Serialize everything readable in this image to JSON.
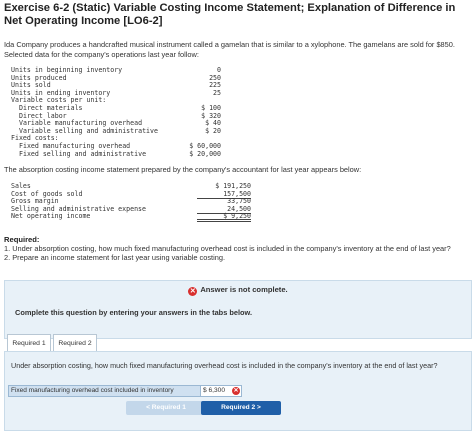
{
  "header": {
    "title": "Exercise 6-2 (Static) Variable Costing Income Statement; Explanation of Difference in Net Operating Income [LO6-2]",
    "intro": "Ida Company produces a handcrafted musical instrument called a gamelan that is similar to a xylophone. The gamelans are sold for $850. Selected data for the company's operations last year follow:"
  },
  "data_table": {
    "rows": [
      {
        "label": "Units in beginning inventory",
        "value": "0"
      },
      {
        "label": "Units produced",
        "value": "250"
      },
      {
        "label": "Units sold",
        "value": "225"
      },
      {
        "label": "Units in ending inventory",
        "value": "25"
      },
      {
        "label": "Variable costs per unit:",
        "value": ""
      },
      {
        "label": "Direct materials",
        "value": "$ 100"
      },
      {
        "label": "Direct labor",
        "value": "$ 320"
      },
      {
        "label": "Variable manufacturing overhead",
        "value": "$ 40"
      },
      {
        "label": "Variable selling and administrative",
        "value": "$ 20"
      },
      {
        "label": "Fixed costs:",
        "value": ""
      },
      {
        "label": "Fixed manufacturing overhead",
        "value": "$ 60,000"
      },
      {
        "label": "Fixed selling and administrative",
        "value": "$ 20,000"
      }
    ]
  },
  "absorption_sentence": "The absorption costing income statement prepared by the company's accountant for last year appears below:",
  "absorption_table": {
    "rows": [
      {
        "label": "Sales",
        "value": "$ 191,250"
      },
      {
        "label": "Cost of goods sold",
        "value": "157,500"
      },
      {
        "label": "Gross margin",
        "value": "33,750"
      },
      {
        "label": "Selling and administrative expense",
        "value": "24,500"
      },
      {
        "label": "Net operating income",
        "value": "$ 9,250"
      }
    ]
  },
  "required": {
    "heading": "Required:",
    "item1": "1. Under absorption costing, how much fixed manufacturing overhead cost is included in the company's inventory at the end of last year?",
    "item2": "2. Prepare an income statement for last year using variable costing."
  },
  "status": {
    "icon": "x-circle-icon",
    "not_complete": "Answer is not complete.",
    "complete_prompt": "Complete this question by entering your answers in the tabs below."
  },
  "tabs": [
    {
      "label": "Required 1",
      "active": true
    },
    {
      "label": "Required 2",
      "active": false
    }
  ],
  "panel": {
    "question": "Under absorption costing, how much fixed manufacturing overhead cost is included in the company's inventory at the end of last year?",
    "answer_label": "Fixed manufacturing overhead cost included in inventory",
    "answer_value": "$ 6,300"
  },
  "nav": {
    "prev_label": "< Required 1",
    "next_label": "Required 2 >"
  },
  "colors": {
    "accent": "#1f5fa8",
    "banner_bg": "#e8f1f8",
    "error": "#d8302f"
  }
}
